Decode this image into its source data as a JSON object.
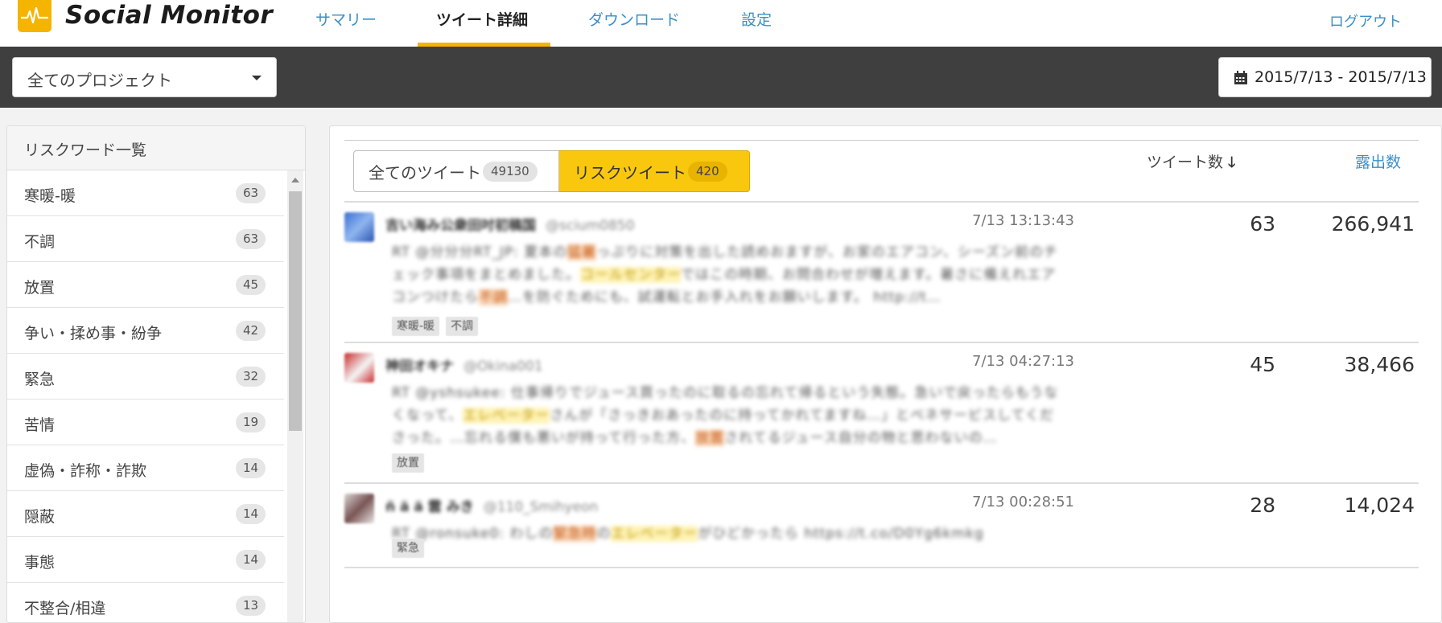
{
  "app": {
    "title": "Social Monitor"
  },
  "nav": {
    "items": [
      {
        "label": "サマリー"
      },
      {
        "label": "ツイート詳細"
      },
      {
        "label": "ダウンロード"
      },
      {
        "label": "設定"
      }
    ],
    "active_index": 1,
    "logout": "ログアウト"
  },
  "toolbar": {
    "project_select": "全てのプロジェクト",
    "date_range": "2015/7/13 - 2015/7/13"
  },
  "sidebar": {
    "title": "リスクワード一覧",
    "items": [
      {
        "label": "寒暖-暖",
        "count": "63"
      },
      {
        "label": "不調",
        "count": "63"
      },
      {
        "label": "放置",
        "count": "45"
      },
      {
        "label": "争い・揉め事・紛争",
        "count": "42"
      },
      {
        "label": "緊急",
        "count": "32"
      },
      {
        "label": "苦情",
        "count": "19"
      },
      {
        "label": "虚偽・詐称・詐欺",
        "count": "14"
      },
      {
        "label": "隠蔽",
        "count": "14"
      },
      {
        "label": "事態",
        "count": "14"
      },
      {
        "label": "不整合/相違",
        "count": "13"
      }
    ]
  },
  "main": {
    "tabs": [
      {
        "label": "全てのツイート",
        "count": "49130"
      },
      {
        "label": "リスクツイート",
        "count": "420"
      }
    ],
    "active_tab": 1,
    "columns": {
      "tweets": "ツイート数",
      "exposure": "露出数"
    },
    "tweets": [
      {
        "user": "吉い海み公衆田吋初稿国",
        "handle": "@scium0850",
        "time": "7/13 13:13:43",
        "body_parts": [
          {
            "text": "RT @分分分RT_JP: 夏本の"
          },
          {
            "text": "猛暑",
            "hl": "o"
          },
          {
            "text": "っぷりに対策を出した読めおますが、お家のエアコン、シーズン前のチェック事項をまとめました。"
          },
          {
            "text": "コールセンター",
            "hl": "y"
          },
          {
            "text": "ではこの時期、お問合わせが増えます。暑さに備えれエアコンつけたら"
          },
          {
            "text": "不調",
            "hl": "o"
          },
          {
            "text": "…を防ぐためにも、試運転とお手入れをお願いします。 http://t…"
          }
        ],
        "tags": [
          "寒暖-暖",
          "不調"
        ],
        "tweet_count": "63",
        "exposure": "266,941"
      },
      {
        "user": "神田オキナ",
        "handle": "@Okina001",
        "time": "7/13 04:27:13",
        "body_parts": [
          {
            "text": "RT @yshsukee: 仕事帰りでジュース買ったのに取るの忘れて帰るという失態。急いで戻ったらもうなくなって、"
          },
          {
            "text": "エレベーター",
            "hl": "y"
          },
          {
            "text": "さんが「さっきおあったのに持ってかれてますね…」とベネサービスしてくださった。…忘れる僕も悪いが持って行った方、"
          },
          {
            "text": "放置",
            "hl": "o"
          },
          {
            "text": "されてるジュース自分の物と思わないの…"
          }
        ],
        "tags": [
          "放置"
        ],
        "tweet_count": "45",
        "exposure": "38,466"
      },
      {
        "user": "ñ ä ä 雲 みき",
        "handle": "@110_Smihyeon",
        "time": "7/13 00:28:51",
        "body_parts": [
          {
            "text": "RT @ronsuke0: わしの"
          },
          {
            "text": "緊急時",
            "hl": "o"
          },
          {
            "text": "の"
          },
          {
            "text": "エレベーター",
            "hl": "y"
          },
          {
            "text": "がひどかったら https://t.co/D0Yg6kmkg"
          }
        ],
        "tags": [
          "緊急"
        ],
        "tweet_count": "28",
        "exposure": "14,024"
      }
    ]
  },
  "colors": {
    "accent": "#f9c80e",
    "link": "#3a8fc7",
    "toolbar": "#3f3f3f",
    "highlight_orange": "#f8d4b5",
    "highlight_yellow": "#fff3b5"
  },
  "icons": {
    "logo": "pulse-wave-icon",
    "select": "caret-down-icon",
    "date": "calendar-icon",
    "sort": "arrow-down-icon"
  }
}
